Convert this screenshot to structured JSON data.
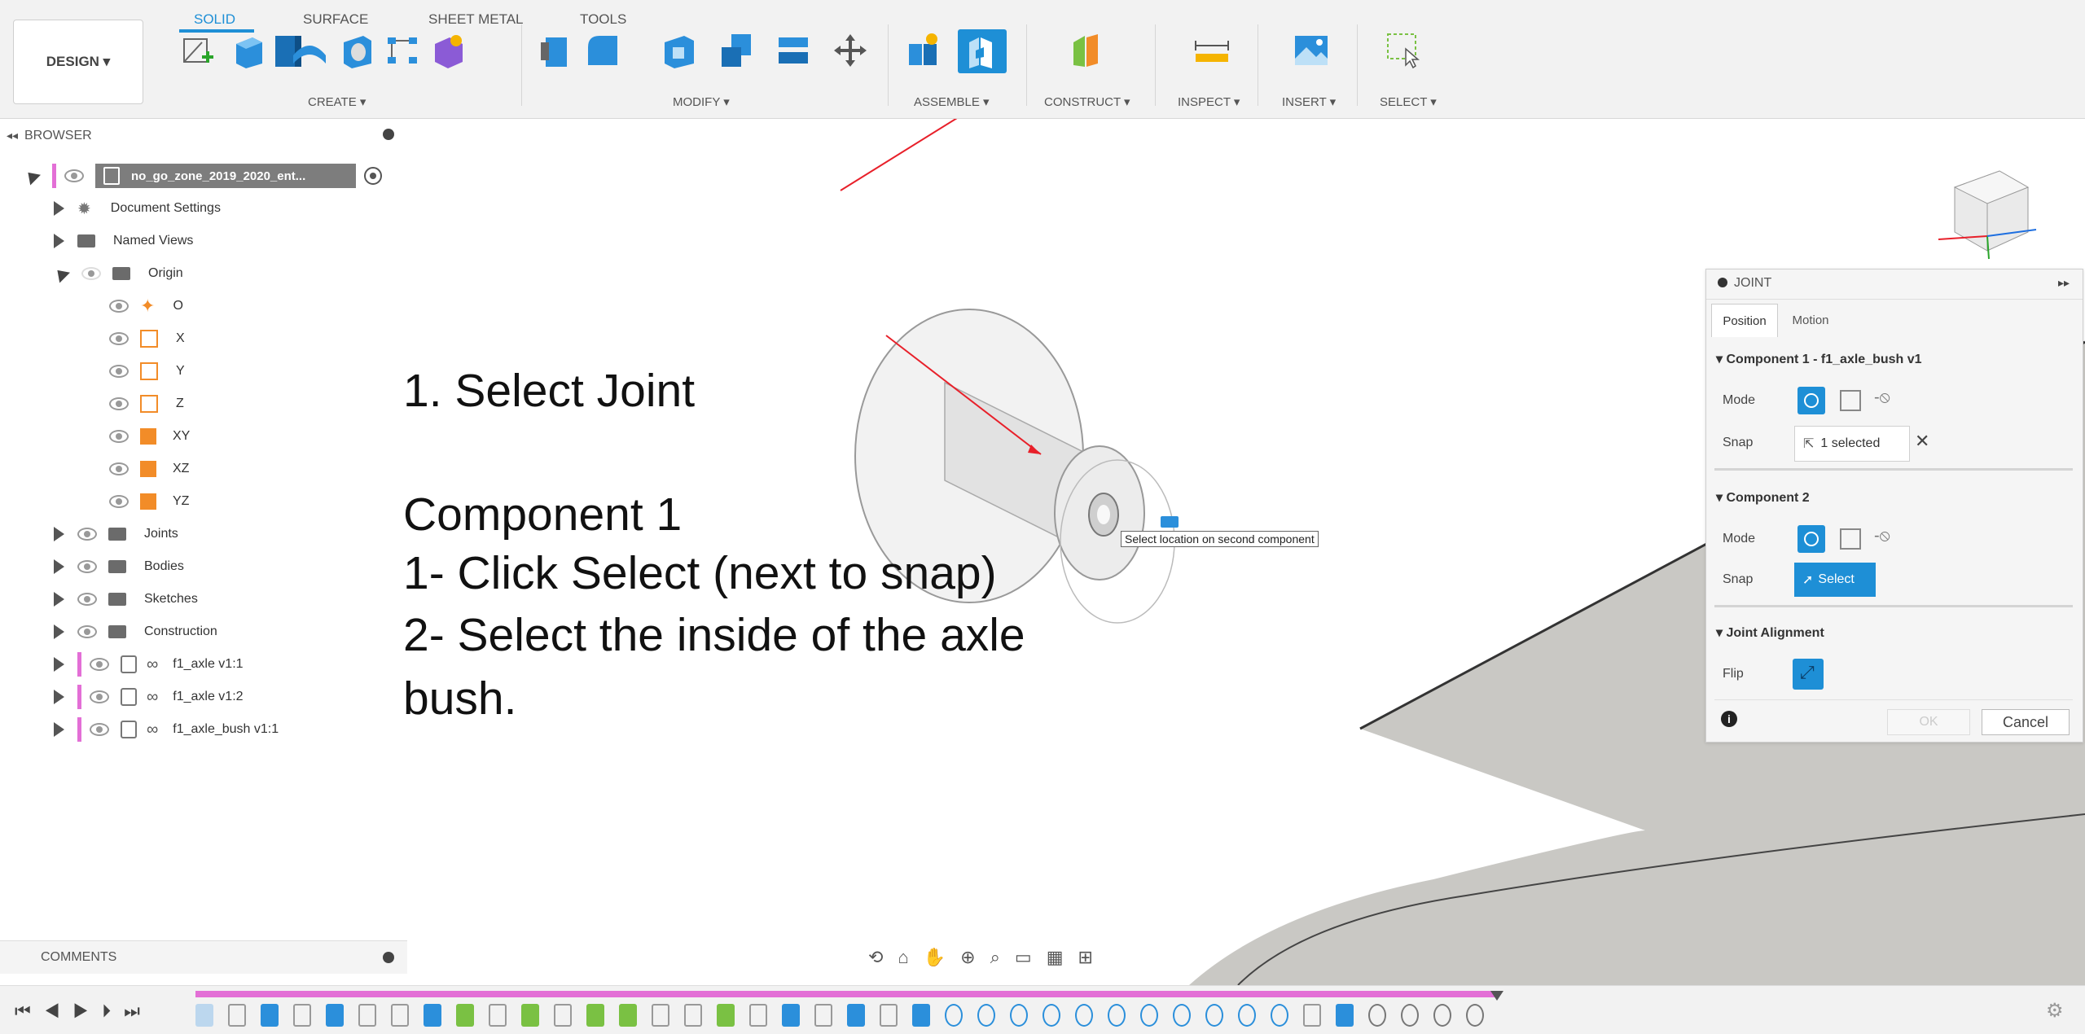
{
  "toolbar": {
    "design_label": "DESIGN ▾",
    "tabs": [
      "SOLID",
      "SURFACE",
      "SHEET METAL",
      "TOOLS"
    ],
    "groups": [
      "CREATE ▾",
      "MODIFY ▾",
      "ASSEMBLE ▾",
      "CONSTRUCT ▾",
      "INSPECT ▾",
      "INSERT ▾",
      "SELECT ▾"
    ]
  },
  "browser": {
    "header": "BROWSER",
    "root": "no_go_zone_2019_2020_ent...",
    "items": [
      "Document Settings",
      "Named Views",
      "Origin",
      "O",
      "X",
      "Y",
      "Z",
      "XY",
      "XZ",
      "YZ",
      "Joints",
      "Bodies",
      "Sketches",
      "Construction",
      "f1_axle v1:1",
      "f1_axle v1:2",
      "f1_axle_bush v1:1"
    ]
  },
  "instructions": {
    "line1": "1. Select Joint",
    "line2": "Component 1",
    "line3": "1- Click Select (next to snap)",
    "line4": "2- Select the inside of the axle",
    "line5": "bush."
  },
  "tooltip": "Select location on second component",
  "joint": {
    "title": "JOINT",
    "tabs": [
      "Position",
      "Motion"
    ],
    "component1": "Component 1 - f1_axle_bush v1",
    "component2": "Component 2",
    "alignment": "Joint Alignment",
    "mode_label": "Mode",
    "snap_label": "Snap",
    "snap1_value": "1 selected",
    "snap2_value": "Select",
    "flip_label": "Flip",
    "ok_label": "OK",
    "cancel_label": "Cancel"
  },
  "comments": {
    "label": "COMMENTS"
  },
  "colors": {
    "accent": "#1e8fd6",
    "annotation": "#e8202a",
    "timeline_bar": "#e36fd6"
  }
}
